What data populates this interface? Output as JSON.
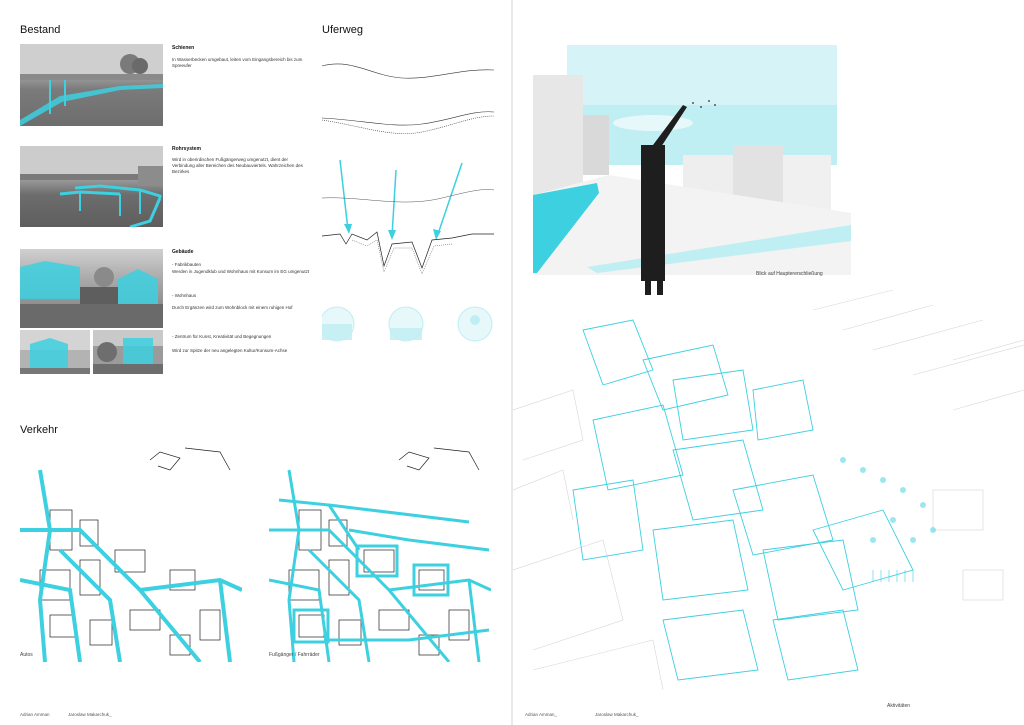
{
  "left": {
    "bestand": {
      "title": "Bestand",
      "schienen": {
        "heading": "Schienen",
        "text": "In Wasserbecken umgebaut, leiten vom Eingangsbereich bis zum Spreeufer"
      },
      "rohrsystem": {
        "heading": "Rohrsystem",
        "text": "Wird in oberirdischen Fußgängerweg umgenutzt, dient der Verbindung aller Bereichen des Neubauviertels. Wahrzeichen des Bezirkes"
      },
      "gebaeude": {
        "heading": "Gebäude",
        "item1_title": "- Fabrikbauten",
        "item1_text": "Werden in Jugendklub und Wohnhaus mit Konsum im EG umgenutzt",
        "item2_title": "- Wohnhaus",
        "item2_text": "Durch Ergänzen wird zum Wohnblock mit einem ruhigen Hof",
        "item3_title": "- Zentrum für Kunst, Kreativität und Begegnungen",
        "item3_text": "Wird zur Spitze der neu angelegten Kultur/Konsum-Achse"
      }
    },
    "uferweg": {
      "title": "Uferweg"
    },
    "verkehr": {
      "title": "Verkehr",
      "map1_caption": "Autos",
      "map2_caption": "Fußgänger / Fahrräder"
    },
    "authors": [
      "Adrian Amman",
      "Jaroslaw Makarchuk_"
    ]
  },
  "right": {
    "render_caption": "Blick auf Hauptererschließung",
    "plan_caption": "Aktivitäten",
    "authors": [
      "Adrian Amman_",
      "Jaroslaw Makarchuk_"
    ]
  },
  "colors": {
    "accent": "#3cd0e0",
    "accent_light": "#bfeef3",
    "line": "#222222"
  }
}
